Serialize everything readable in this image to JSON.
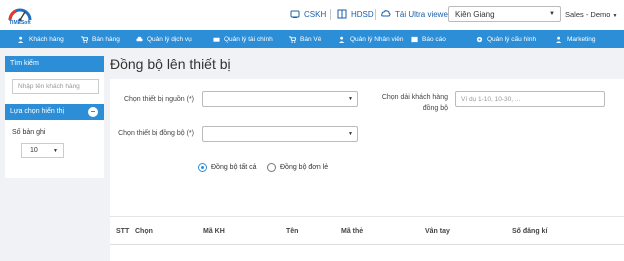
{
  "header": {
    "logo_text": "TIMESoft",
    "links": {
      "support": "CSKH",
      "guide": "HDSD",
      "download": "Tải Ultra viewer"
    },
    "province": "Kiên Giang",
    "user": "Sales - Demo"
  },
  "nav": {
    "items": [
      {
        "label": "Khách hàng",
        "icon": "users-icon"
      },
      {
        "label": "Bán hàng",
        "icon": "cart-icon"
      },
      {
        "label": "Quản lý dịch vụ",
        "icon": "car-icon"
      },
      {
        "label": "Quản lý tài chính",
        "icon": "money-icon"
      },
      {
        "label": "Bán Vé",
        "icon": "cart-icon"
      },
      {
        "label": "Quản lý Nhân viên",
        "icon": "users-icon"
      },
      {
        "label": "Báo cáo",
        "icon": "report-icon"
      },
      {
        "label": "Quản lý cấu hình",
        "icon": "gear-icon"
      },
      {
        "label": "Marketing",
        "icon": "users-icon"
      }
    ]
  },
  "sidebar": {
    "search_title": "Tìm kiếm",
    "search_placeholder": "Nhập tên khách hàng",
    "display_title": "Lựa chọn hiển thị",
    "records_label": "Số bản ghi",
    "records_value": "10"
  },
  "main": {
    "title": "Đồng bộ lên thiết bị",
    "source_device_label": "Chọn thiết bị nguồn (*)",
    "sync_device_label": "Chọn thiết bị đồng bộ (*)",
    "customer_range_label": "Chọn dải khách hàng đồng bộ",
    "customer_range_placeholder": "Ví dụ 1-10, 10-30, ...",
    "radio_all": "Đồng bộ tất cả",
    "radio_single": "Đồng bộ đơn lẻ"
  },
  "table": {
    "columns": [
      "STT",
      "Chọn",
      "Mã KH",
      "Tên",
      "Mã thẻ",
      "Vân tay",
      "Số đăng kí"
    ]
  },
  "colors": {
    "primary": "#2d8ed8",
    "link": "#1a5fa8",
    "background": "#f0f2f5"
  }
}
